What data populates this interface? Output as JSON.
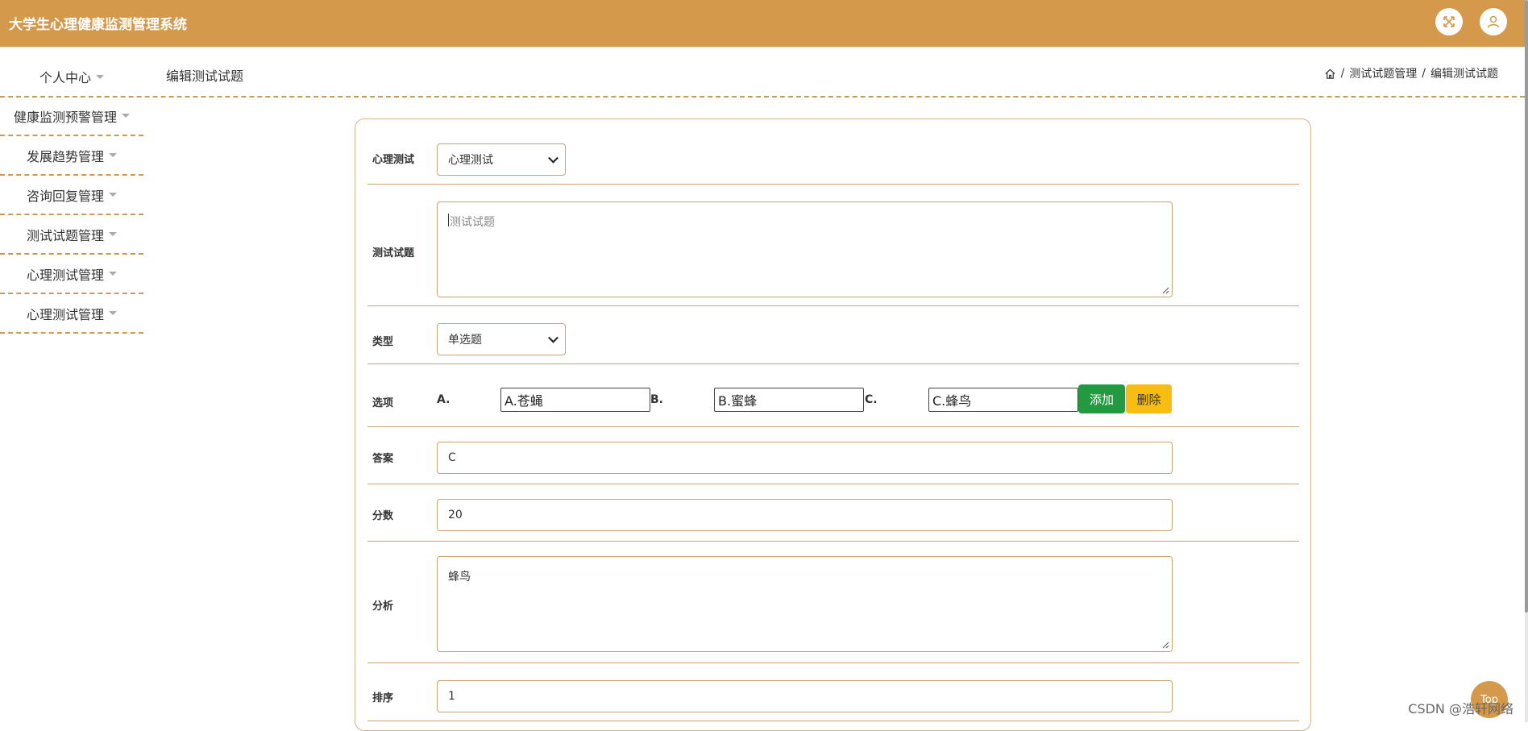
{
  "header": {
    "title": "大学生心理健康监测管理系统"
  },
  "sidebar": {
    "items": [
      {
        "label": "个人中心"
      },
      {
        "label": "健康监测预警管理"
      },
      {
        "label": "发展趋势管理"
      },
      {
        "label": "咨询回复管理"
      },
      {
        "label": "测试试题管理"
      },
      {
        "label": "心理测试管理"
      },
      {
        "label": "心理测试管理"
      }
    ]
  },
  "page": {
    "title": "编辑测试试题",
    "breadcrumb": [
      "测试试题管理",
      "编辑测试试题"
    ]
  },
  "form": {
    "test_label": "心理测试",
    "test_value": "心理测试",
    "question_label": "测试试题",
    "question_placeholder": "测试试题",
    "type_label": "类型",
    "type_value": "单选题",
    "options_label": "选项",
    "options": [
      {
        "letter": "A.",
        "value": "A.苍蝇"
      },
      {
        "letter": "B.",
        "value": "B.蜜蜂"
      },
      {
        "letter": "C.",
        "value": "C.蜂鸟"
      }
    ],
    "add_button": "添加",
    "delete_button": "删除",
    "answer_label": "答案",
    "answer_value": "C",
    "score_label": "分数",
    "score_value": "20",
    "analysis_label": "分析",
    "analysis_value": "蜂鸟",
    "sort_label": "排序",
    "sort_value": "1"
  },
  "float": {
    "top_button": "Top"
  },
  "watermark": "CSDN @浩轩网络",
  "colors": {
    "brand": "#d4994a",
    "add_button": "#239a3f",
    "delete_button": "#f7bd13"
  }
}
